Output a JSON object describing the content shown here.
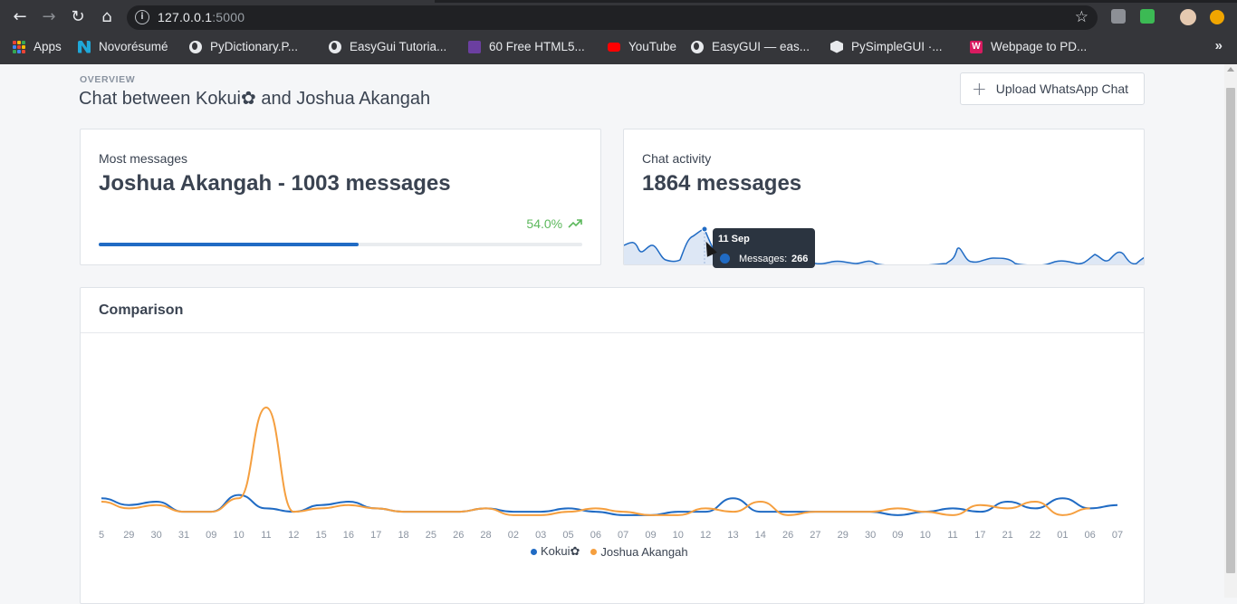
{
  "browser": {
    "url_host": "127.0.0.1",
    "url_port": ":5000",
    "bookmarks": [
      {
        "label": "Apps",
        "icon": "apps-grid-icon"
      },
      {
        "label": "Novorésumé",
        "icon": "novoresume-icon"
      },
      {
        "label": "PyDictionary.P...",
        "icon": "globe-icon"
      },
      {
        "label": "EasyGui Tutoria...",
        "icon": "globe-icon"
      },
      {
        "label": "60 Free HTML5...",
        "icon": "colorlib-icon"
      },
      {
        "label": "YouTube",
        "icon": "youtube-icon"
      },
      {
        "label": "EasyGUI — eas...",
        "icon": "globe-icon"
      },
      {
        "label": "PySimpleGUI ·...",
        "icon": "hexagon-icon"
      },
      {
        "label": "Webpage to PD...",
        "icon": "w-logo-icon"
      }
    ]
  },
  "header": {
    "overline": "OVERVIEW",
    "title": "Chat between Kokui✿ and Joshua Akangah",
    "upload_label": "Upload WhatsApp Chat"
  },
  "most_messages": {
    "label": "Most messages",
    "value": "Joshua Akangah - 1003 messages",
    "percent": "54.0%",
    "progress_fraction": 0.538
  },
  "activity": {
    "label": "Chat activity",
    "value": "1864 messages",
    "tooltip": {
      "date": "11 Sep",
      "label": "Messages:",
      "value": "266"
    }
  },
  "colors": {
    "blue": "#206bc4",
    "orange": "#f59f3f",
    "green": "#5cb85c"
  },
  "comparison": {
    "title": "Comparison"
  },
  "chart_data": {
    "type": "line",
    "categories": [
      "5",
      "29",
      "30",
      "31",
      "09",
      "10",
      "11",
      "12",
      "15",
      "16",
      "17",
      "18",
      "25",
      "26",
      "28",
      "02",
      "03",
      "05",
      "06",
      "07",
      "09",
      "10",
      "12",
      "13",
      "14",
      "26",
      "27",
      "29",
      "30",
      "09",
      "10",
      "11",
      "17",
      "21",
      "22",
      "01",
      "06",
      "07"
    ],
    "series": [
      {
        "name": "Kokui✿",
        "color": "#206bc4",
        "values": [
          8,
          6,
          7,
          4,
          4,
          9,
          5,
          4,
          6,
          7,
          5,
          4,
          4,
          4,
          5,
          4,
          4,
          5,
          4,
          3,
          3,
          4,
          4,
          8,
          4,
          4,
          4,
          4,
          4,
          3,
          4,
          5,
          4,
          7,
          5,
          8,
          5,
          6
        ]
      },
      {
        "name": "Joshua Akangah",
        "color": "#f59f3f",
        "values": [
          7,
          5,
          6,
          4,
          4,
          8,
          35,
          4,
          5,
          6,
          5,
          4,
          4,
          4,
          5,
          3,
          3,
          4,
          5,
          4,
          3,
          3,
          5,
          4,
          7,
          3,
          4,
          4,
          4,
          5,
          4,
          3,
          6,
          5,
          7,
          3,
          5,
          null
        ]
      }
    ],
    "legend_position": "bottom"
  }
}
